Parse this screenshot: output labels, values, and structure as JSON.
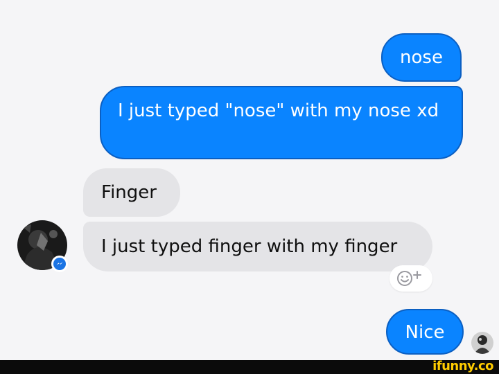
{
  "conversation": {
    "messages": [
      {
        "sender": "me",
        "text": "nose"
      },
      {
        "sender": "me",
        "text": "I just typed \"nose\" with my nose xd"
      },
      {
        "sender": "contact",
        "text": "Finger"
      },
      {
        "sender": "contact",
        "text": "I just typed finger with my finger"
      },
      {
        "sender": "me",
        "text": "Nice"
      }
    ],
    "reaction_button": {
      "icon": "smiley-plus-icon"
    }
  },
  "avatars": {
    "contact": {
      "icon": "contact-avatar",
      "badge_icon": "messenger-badge-icon"
    },
    "me": {
      "icon": "seen-avatar"
    }
  },
  "colors": {
    "outgoing_bubble": "#0a84ff",
    "incoming_bubble": "#e4e4e7",
    "background": "#f5f5f7",
    "watermark": "#ffcc00"
  },
  "watermark": {
    "text": "ifunny.co"
  }
}
